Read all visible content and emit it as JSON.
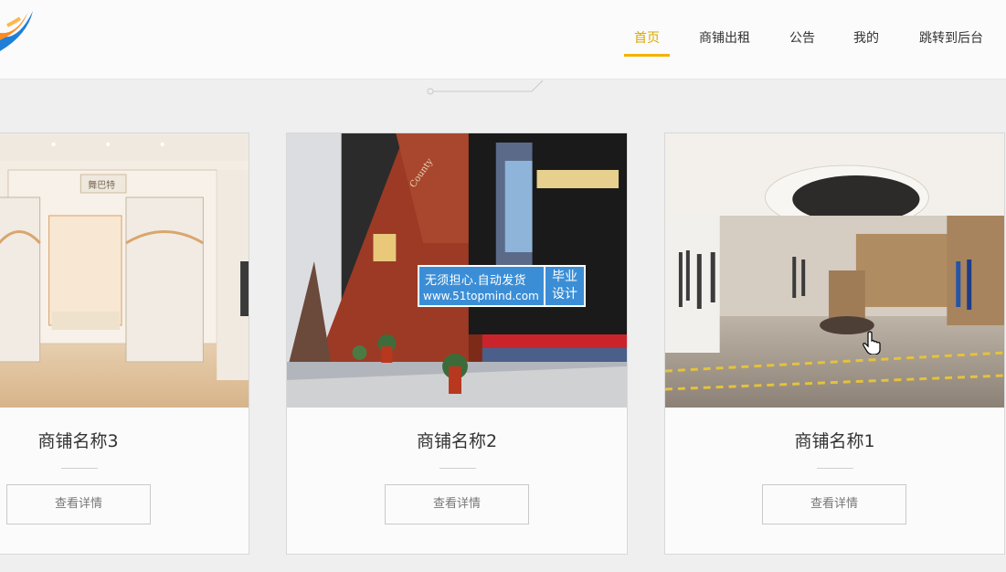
{
  "nav": {
    "items": [
      {
        "label": "首页",
        "active": true
      },
      {
        "label": "商铺出租",
        "active": false
      },
      {
        "label": "公告",
        "active": false
      },
      {
        "label": "我的",
        "active": false
      },
      {
        "label": "跳转到后台",
        "active": false
      }
    ]
  },
  "shops": [
    {
      "name": "商铺名称3",
      "details_label": "查看详情",
      "sign_text": "舞巴特"
    },
    {
      "name": "商铺名称2",
      "details_label": "查看详情"
    },
    {
      "name": "商铺名称1",
      "details_label": "查看详情"
    }
  ],
  "watermark": {
    "line1": "无须担心.自动发货",
    "line2": "www.51topmind.com",
    "right_top": "毕业",
    "right_bottom": "设计"
  },
  "colors": {
    "accent": "#f3b300",
    "active_nav_text": "#d9a800",
    "watermark_bg": "#3b8ed6"
  }
}
